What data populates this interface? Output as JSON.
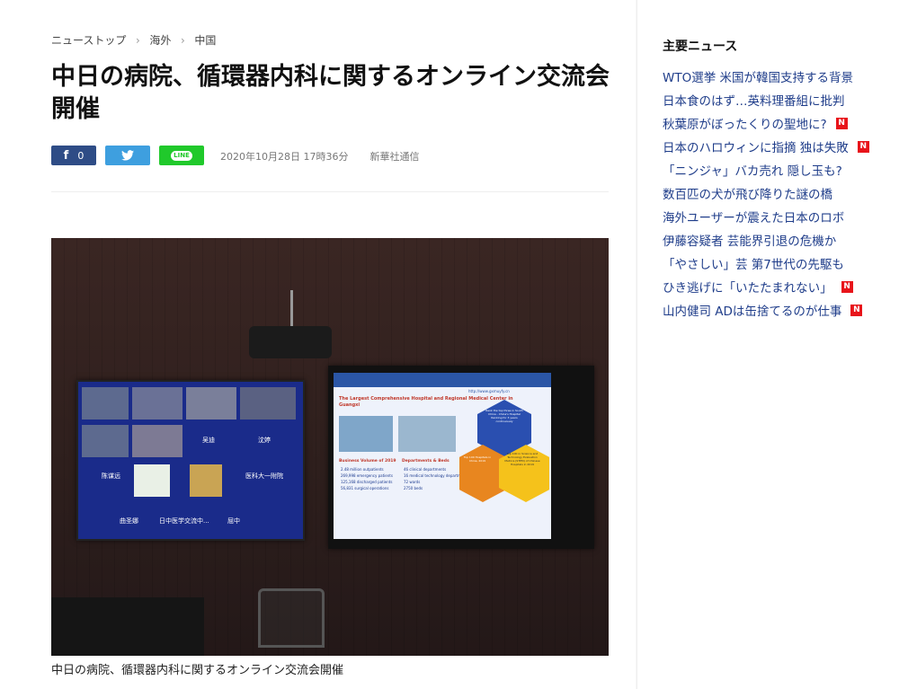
{
  "breadcrumb": [
    "ニューストップ",
    "海外",
    "中国"
  ],
  "article": {
    "title": "中日の病院、循環器内科に関するオンライン交流会開催",
    "date": "2020年10月28日 17時36分",
    "source": "新華社通信",
    "caption": "中日の病院、循環器内科に関するオンライン交流会開催",
    "share": {
      "facebook_count": "0"
    }
  },
  "photo": {
    "left_screen_names": [
      "吴迪",
      "沈婷",
      "陈谋远",
      "医科大一附院",
      "曲圣娜",
      "日中医学交流中...",
      "屈中"
    ],
    "slide_title": "The Largest Comprehensive Hospital and Regional Medical Center in Guangxi",
    "slide_left_heading": "Business Volume of 2019",
    "slide_left_items": [
      "2.48 million outpatients",
      "269,998 emergency patients",
      "125,168 discharged patients",
      "56,831 surgical operations"
    ],
    "slide_right_heading": "Departments & Beds",
    "slide_right_items": [
      "46 clinical departments",
      "16 medical technology departments",
      "72 wards",
      "2750 beds"
    ],
    "slide_hex_top": "Rank the top three in South China - China's Hospital Ranking for 3 years continuously",
    "slide_hex_left": "Top 100 Hospitals in China, 2019",
    "slide_hex_right": "Top 100 in Science and Technology Evaluation Metrics (STEM) of Chinese Hospitals in 2019",
    "slide_url": "http://www.gxmuyfy.cn"
  },
  "sidebar": {
    "heading": "主要ニュース",
    "items": [
      {
        "text": "WTO選挙 米国が韓国支持する背景",
        "new": false
      },
      {
        "text": "日本食のはず…英料理番組に批判",
        "new": false
      },
      {
        "text": "秋葉原がぼったくりの聖地に?",
        "new": true
      },
      {
        "text": "日本のハロウィンに指摘 独は失敗",
        "new": true
      },
      {
        "text": "「ニンジャ」バカ売れ 隠し玉も?",
        "new": false
      },
      {
        "text": "数百匹の犬が飛び降りた謎の橋",
        "new": false
      },
      {
        "text": "海外ユーザーが震えた日本のロボ",
        "new": false
      },
      {
        "text": "伊藤容疑者 芸能界引退の危機か",
        "new": false
      },
      {
        "text": "「やさしい」芸 第7世代の先駆も",
        "new": false
      },
      {
        "text": "ひき逃げに「いたたまれない」",
        "new": true
      },
      {
        "text": "山内健司 ADは缶捨てるのが仕事",
        "new": true
      }
    ],
    "badge_label": "N"
  },
  "colors": {
    "facebook": "#2e4c86",
    "twitter": "#3e9fdf",
    "line": "#20c92b",
    "new_badge": "#e8141a",
    "link": "#1f3d8a"
  }
}
